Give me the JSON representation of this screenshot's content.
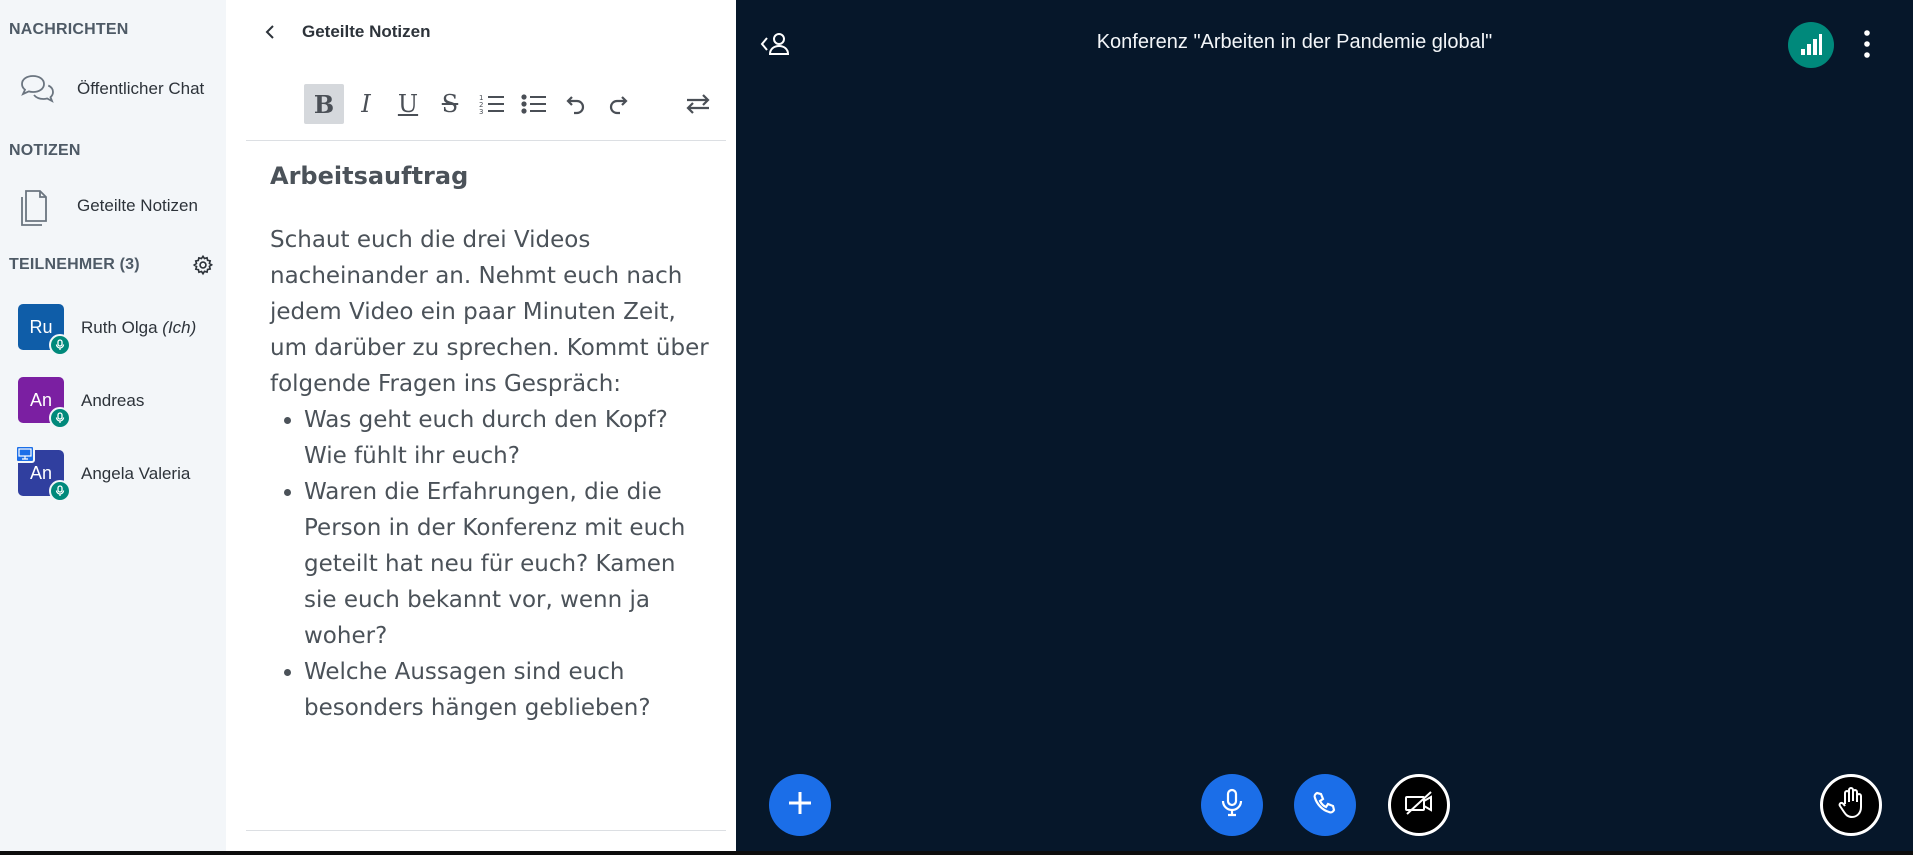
{
  "sidebar": {
    "messages_title": "NACHRICHTEN",
    "public_chat": "Öffentlicher Chat",
    "notes_title": "NOTIZEN",
    "shared_notes": "Geteilte Notizen",
    "participants_title": "TEILNEHMER (3)",
    "users": [
      {
        "initials": "Ru",
        "name": "Ruth Olga",
        "suffix": "(Ich)",
        "color": "#0f5da8"
      },
      {
        "initials": "An",
        "name": "Andreas",
        "suffix": "",
        "color": "#7b1fa2"
      },
      {
        "initials": "An",
        "name": "Angela Valeria",
        "suffix": "",
        "color": "#303f9f"
      }
    ]
  },
  "notes": {
    "header_title": "Geteilte Notizen",
    "toolbar": [
      "bold",
      "italic",
      "underline",
      "strikethrough",
      "ordered-list",
      "unordered-list",
      "undo",
      "redo",
      "direction-toggle"
    ],
    "heading": "Arbeitsauftrag",
    "paragraph": "Schaut euch die drei Videos nacheinander an. Nehmt euch nach jedem Video ein paar Minuten Zeit, um darüber zu sprechen. Kommt über folgende Fragen ins Gespräch:",
    "bullets": [
      "Was geht euch durch den Kopf? Wie fühlt ihr euch?",
      "Waren die Erfahrungen, die die Person in der Konferenz mit euch geteilt hat neu für euch? Kamen sie euch bekannt vor, wenn ja woher?",
      "Welche Aussagen sind euch besonders hängen geblieben?"
    ]
  },
  "main": {
    "title": "Konferenz \"Arbeiten in der Pandemie global\"",
    "colors": {
      "background": "#06172a",
      "accent": "#1b6ee8",
      "connection": "#00897b"
    }
  }
}
